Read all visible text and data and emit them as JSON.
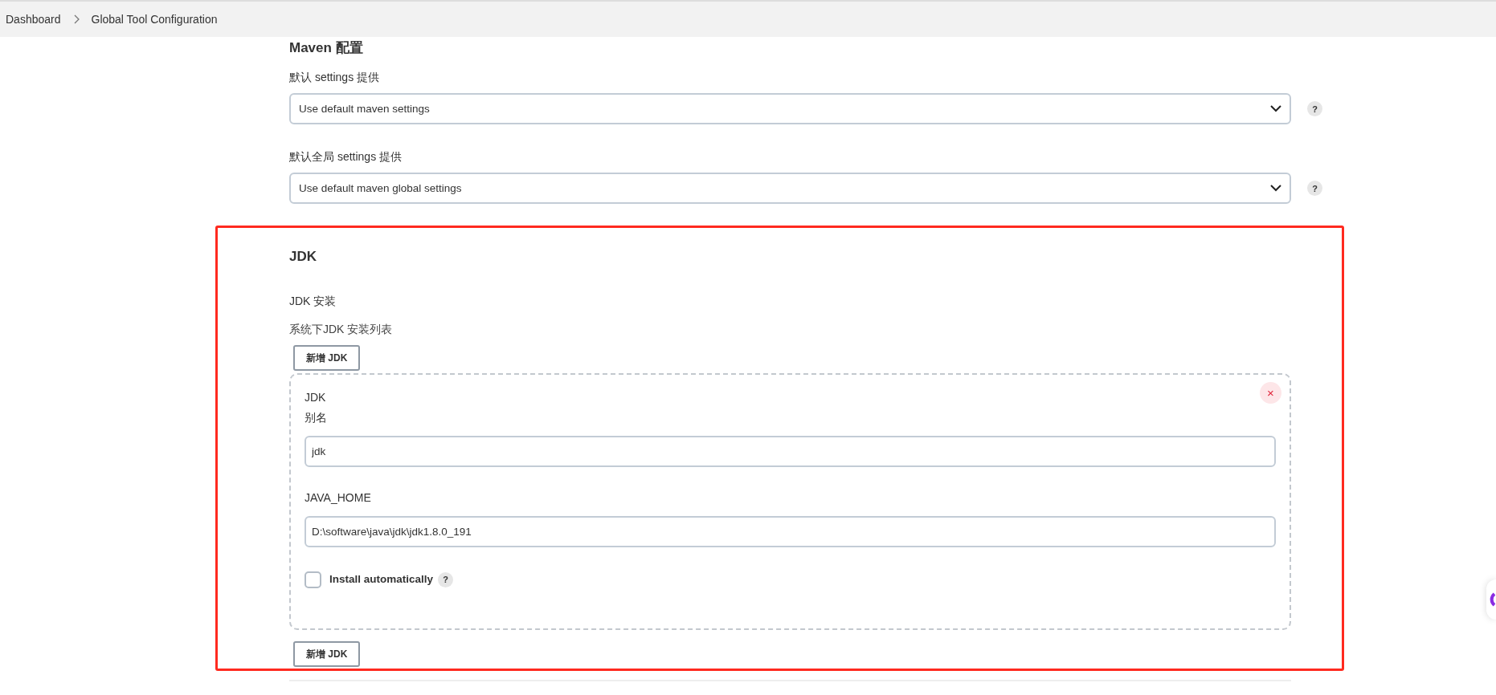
{
  "breadcrumb": [
    {
      "label": "Dashboard"
    },
    {
      "label": "Global Tool Configuration"
    }
  ],
  "maven": {
    "title": "Maven 配置",
    "fields": [
      {
        "label": "默认 settings 提供",
        "value": "Use default maven settings"
      },
      {
        "label": "默认全局 settings 提供",
        "value": "Use default maven global settings"
      }
    ]
  },
  "jdk": {
    "title": "JDK",
    "install_label": "JDK 安装",
    "description": "系统下JDK 安装列表",
    "add_button": "新增 JDK",
    "installations": [
      {
        "heading": "JDK",
        "alias_label": "别名",
        "alias_value": "jdk",
        "home_label": "JAVA_HOME",
        "home_value": "D:\\software\\java\\jdk\\jdk1.8.0_191",
        "install_auto": {
          "label": "Install automatically",
          "checked": false
        }
      }
    ],
    "add_button_bottom": "新增 JDK"
  },
  "help_mark": "?",
  "close_mark": "×"
}
